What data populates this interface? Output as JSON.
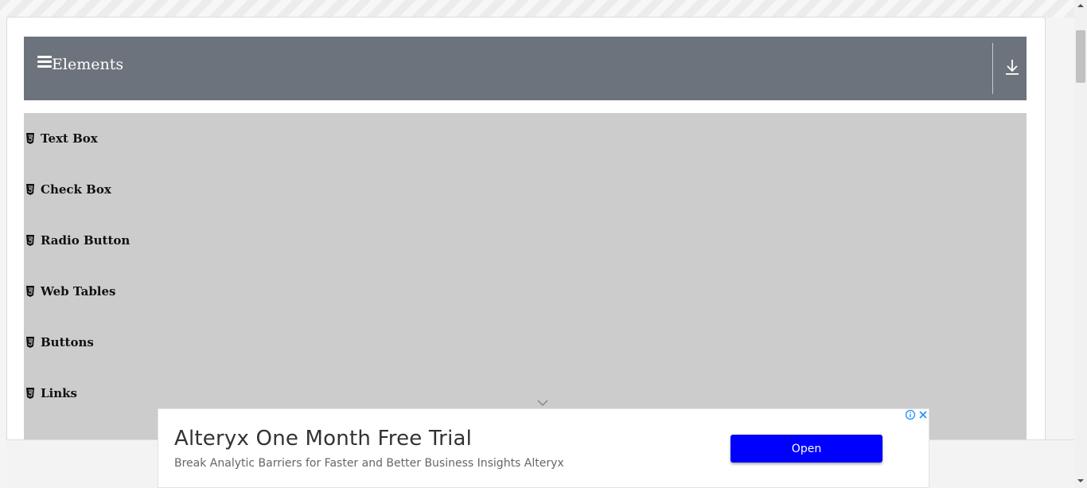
{
  "group": {
    "title": "Elements"
  },
  "menu": {
    "items": [
      {
        "label": "Text Box"
      },
      {
        "label": "Check Box"
      },
      {
        "label": "Radio Button"
      },
      {
        "label": "Web Tables"
      },
      {
        "label": "Buttons"
      },
      {
        "label": "Links"
      }
    ]
  },
  "ad": {
    "headline": "Alteryx One Month Free Trial",
    "description": "Break Analytic Barriers for Faster and Better Business Insights Alteryx",
    "button_label": "Open"
  },
  "colors": {
    "header_bg": "#6c737c",
    "menu_bg": "#cccccc",
    "ad_button": "#0000ff"
  },
  "icons": {
    "hamburger": "hamburger-icon",
    "collapse": "download-arrow-icon",
    "item": "html5-icon",
    "adchoices": "info-icon",
    "ad_close": "close-icon",
    "ad_collapse": "chevron-down-icon"
  }
}
